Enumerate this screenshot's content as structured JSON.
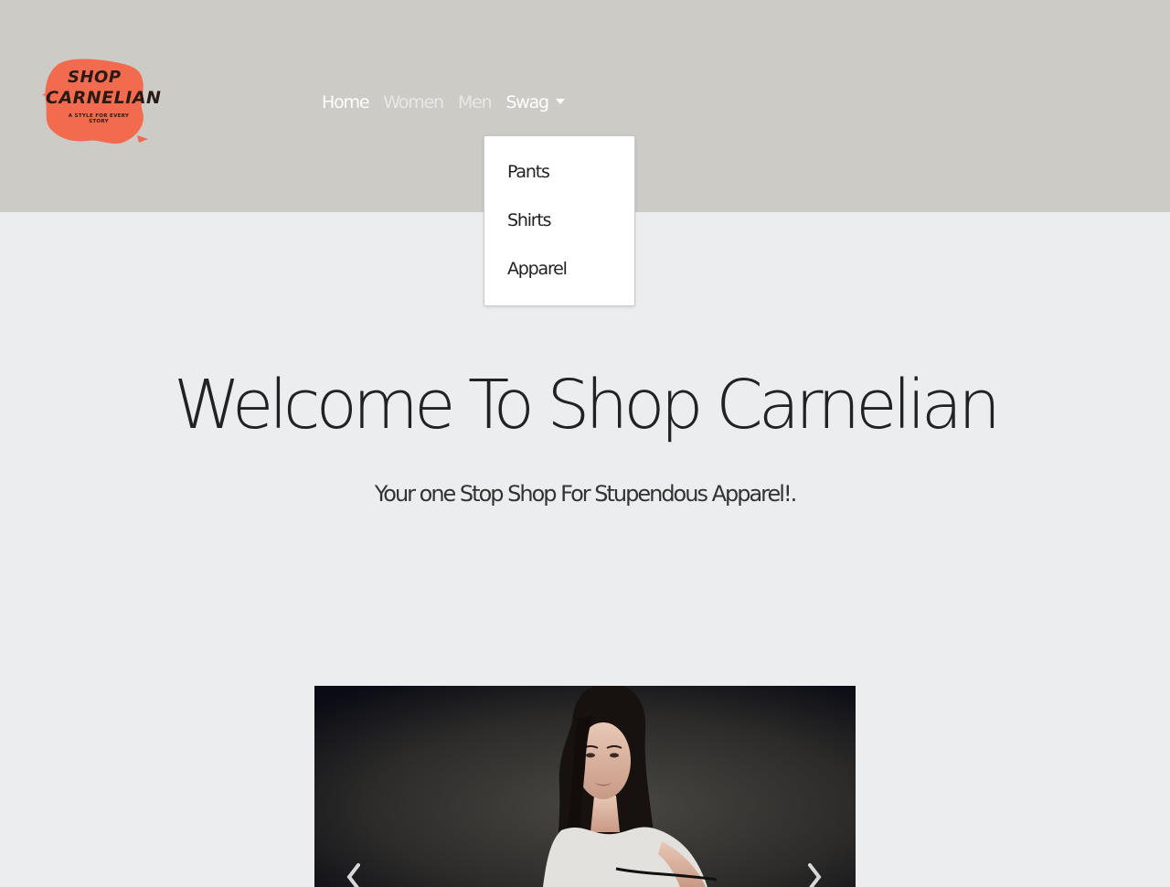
{
  "brand": {
    "logo_line1": "SHOP",
    "logo_line2": "CARNELIAN",
    "logo_tagline": "A STYLE FOR EVERY STORY",
    "logo_color": "#f26b4f"
  },
  "nav": {
    "items": [
      {
        "label": "Home",
        "active": true
      },
      {
        "label": "Women",
        "active": false
      },
      {
        "label": "Men",
        "active": false
      },
      {
        "label": "Swag",
        "active": false,
        "dropdown": true
      }
    ]
  },
  "dropdown": {
    "open": true,
    "items": [
      {
        "label": "Pants"
      },
      {
        "label": "Shirts"
      },
      {
        "label": "Apparel"
      }
    ]
  },
  "hero": {
    "title": "Welcome To Shop Carnelian",
    "subtitle": "Your one Stop Shop For Stupendous Apparel!."
  },
  "carousel": {
    "prev_icon": "chevron-left-icon",
    "next_icon": "chevron-right-icon"
  },
  "colors": {
    "navbar_bg": "#cccbc6",
    "page_bg": "#ecedef",
    "text_dark": "#222222"
  }
}
